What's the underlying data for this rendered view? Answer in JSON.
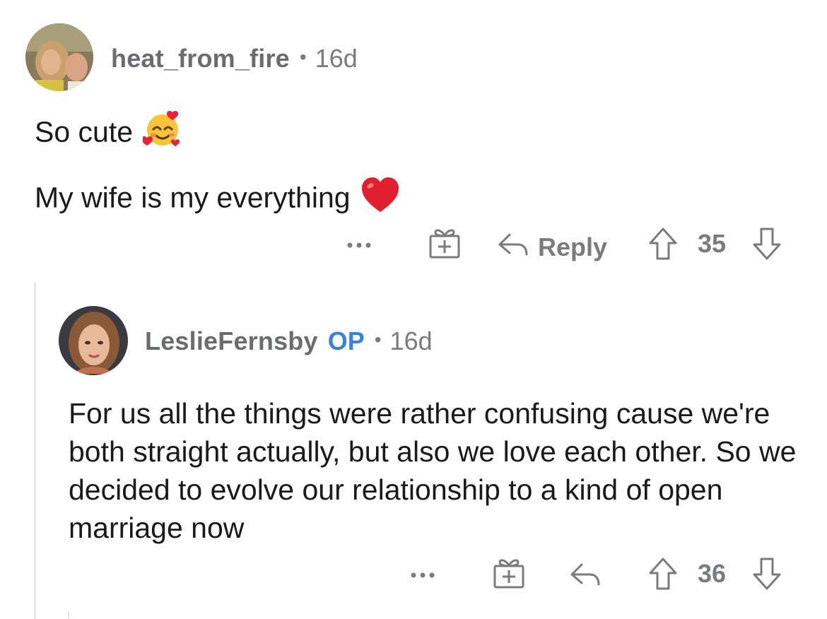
{
  "comments": [
    {
      "username": "heat_from_fire",
      "separator": "•",
      "age": "16d",
      "lines": [
        "So cute",
        "My wife is my everything"
      ],
      "emojis": [
        "smiling-face-with-hearts",
        "red-heart"
      ],
      "actions": {
        "more": "...",
        "reply_label": "Reply",
        "score": "35"
      }
    },
    {
      "username": "LeslieFernsby",
      "badge": "OP",
      "separator": "•",
      "age": "16d",
      "body": "For us all the things were rather confusing cause we're both straight actually, but also we love each other. So we decided to evolve our relationship to a kind of open marriage now",
      "actions": {
        "more": "...",
        "score": "36"
      }
    }
  ],
  "colors": {
    "text": "#1a1a1b",
    "meta": "#787c7e",
    "op_badge": "#3c83d6",
    "thread_line": "#e6e6e6"
  }
}
